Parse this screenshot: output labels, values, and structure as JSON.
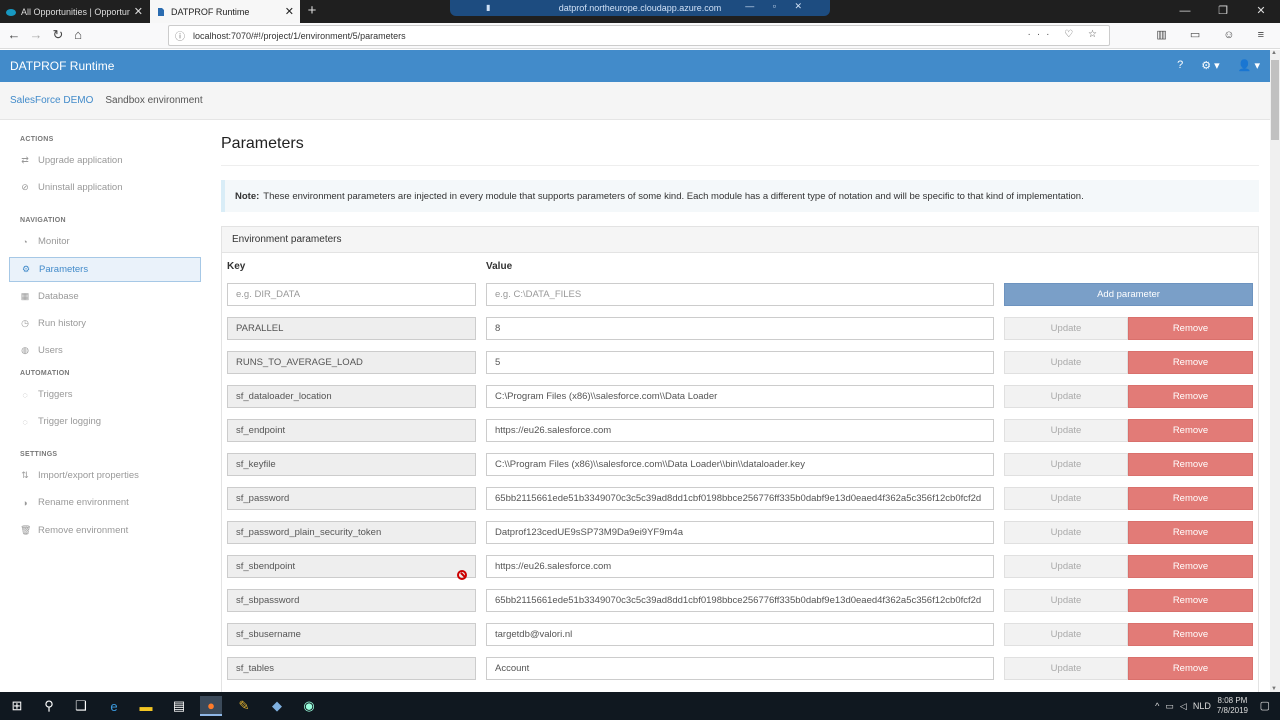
{
  "browser": {
    "tabs": [
      {
        "label": "All Opportunities | Opportunit..."
      },
      {
        "label": "DATPROF Runtime"
      }
    ],
    "url": "localhost:7070/#!/project/1/environment/5/parameters",
    "remote_title": "datprof.northeurope.cloudapp.azure.com"
  },
  "app": {
    "brand": "DATPROF Runtime",
    "breadcrumb": [
      "SalesForce DEMO",
      "Sandbox environment"
    ]
  },
  "sidebar": {
    "sections": [
      {
        "title": "ACTIONS",
        "items": [
          {
            "label": "Upgrade application",
            "icon": "transfer-icon"
          },
          {
            "label": "Uninstall application",
            "icon": "cancel-circle-icon"
          }
        ]
      },
      {
        "title": "NAVIGATION",
        "items": [
          {
            "label": "Monitor",
            "icon": "monitor-icon"
          },
          {
            "label": "Parameters",
            "icon": "gear-icon"
          },
          {
            "label": "Database",
            "icon": "database-icon"
          },
          {
            "label": "Run history",
            "icon": "clock-icon"
          },
          {
            "label": "Users",
            "icon": "users-icon"
          }
        ]
      },
      {
        "title": "AUTOMATION",
        "items": [
          {
            "label": "Triggers",
            "icon": "trigger-icon"
          },
          {
            "label": "Trigger logging",
            "icon": "log-icon"
          }
        ]
      },
      {
        "title": "SETTINGS",
        "items": [
          {
            "label": "Import/export properties",
            "icon": "import-export-icon"
          },
          {
            "label": "Rename environment",
            "icon": "rename-icon"
          },
          {
            "label": "Remove environment",
            "icon": "trash-icon"
          }
        ]
      }
    ]
  },
  "main": {
    "title": "Parameters",
    "note_label": "Note:",
    "note_text": "These environment parameters are injected in every module that supports parameters of some kind. Each module has a different type of notation and will be specific to that kind of implementation.",
    "panel_title": "Environment parameters",
    "col_key": "Key",
    "col_value": "Value",
    "new_row": {
      "key_placeholder": "e.g. DIR_DATA",
      "value_placeholder": "e.g. C:\\DATA_FILES",
      "add_label": "Add parameter"
    },
    "update_label": "Update",
    "remove_label": "Remove",
    "parameters": [
      {
        "key": "PARALLEL",
        "value": "8"
      },
      {
        "key": "RUNS_TO_AVERAGE_LOAD",
        "value": "5"
      },
      {
        "key": "sf_dataloader_location",
        "value": "C:\\Program Files (x86)\\\\salesforce.com\\\\Data Loader"
      },
      {
        "key": "sf_endpoint",
        "value": "https://eu26.salesforce.com"
      },
      {
        "key": "sf_keyfile",
        "value": "C:\\\\Program Files (x86)\\\\salesforce.com\\\\Data Loader\\\\bin\\\\dataloader.key"
      },
      {
        "key": "sf_password",
        "value": "65bb2115661ede51b3349070c3c5c39ad8dd1cbf0198bbce256776ff335b0dabf9e13d0eaed4f362a5c356f12cb0fcf2d"
      },
      {
        "key": "sf_password_plain_security_token",
        "value": "Datprof123cedUE9sSP73M9Da9ei9YF9m4a"
      },
      {
        "key": "sf_sbendpoint",
        "value": "https://eu26.salesforce.com"
      },
      {
        "key": "sf_sbpassword",
        "value": "65bb2115661ede51b3349070c3c5c39ad8dd1cbf0198bbce256776ff335b0dabf9e13d0eaed4f362a5c356f12cb0fcf2d"
      },
      {
        "key": "sf_sbusername",
        "value": "targetdb@valori.nl"
      },
      {
        "key": "sf_tables",
        "value": "Account"
      }
    ]
  },
  "taskbar": {
    "language": "NLD",
    "time": "8:08 PM",
    "date": "7/8/2019"
  },
  "colors": {
    "header": "#428bca",
    "remove": "#e27b77",
    "add": "#7a9fc8"
  }
}
